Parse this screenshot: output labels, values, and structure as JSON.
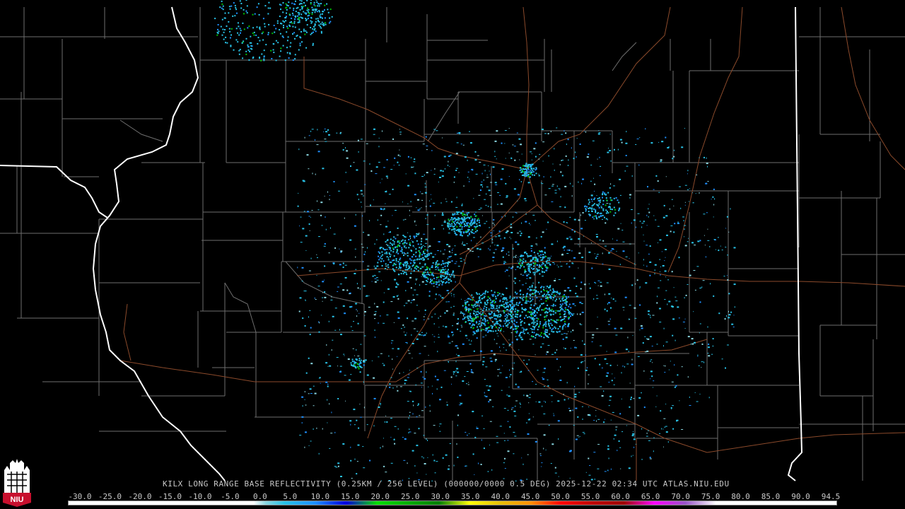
{
  "product": {
    "caption": "KILX LONG RANGE BASE REFLECTIVITY (0.25KM / 256 LEVEL) (000000/0000 0.5 DEG) 2025-12-22 02:34 UTC  ATLAS.NIU.EDU",
    "station": "KILX",
    "datetime": "2025-12-22 02:34 UTC",
    "source": "ATLAS.NIU.EDU"
  },
  "logo": {
    "text": "NIU",
    "bg_color": "#c8102e"
  },
  "colorbar": {
    "ticks": [
      "-30.0",
      "-25.0",
      "-20.0",
      "-15.0",
      "-10.0",
      "-5.0",
      "0.0",
      "5.0",
      "10.0",
      "15.0",
      "20.0",
      "25.0",
      "30.0",
      "35.0",
      "40.0",
      "45.0",
      "50.0",
      "55.0",
      "60.0",
      "65.0",
      "70.0",
      "75.0",
      "80.0",
      "85.0",
      "90.0",
      "94.5"
    ],
    "stops": [
      {
        "dbz": -30,
        "color": "#ffffff"
      },
      {
        "dbz": 0,
        "color": "#ffffff"
      },
      {
        "dbz": 2,
        "color": "#8ad6e0"
      },
      {
        "dbz": 5,
        "color": "#29c3e8"
      },
      {
        "dbz": 10,
        "color": "#1e90ff"
      },
      {
        "dbz": 15,
        "color": "#0000e0"
      },
      {
        "dbz": 20,
        "color": "#00e000"
      },
      {
        "dbz": 25,
        "color": "#00b000"
      },
      {
        "dbz": 30,
        "color": "#008000"
      },
      {
        "dbz": 35,
        "color": "#ffff00"
      },
      {
        "dbz": 40,
        "color": "#e8c000"
      },
      {
        "dbz": 45,
        "color": "#ff9000"
      },
      {
        "dbz": 50,
        "color": "#ff0000"
      },
      {
        "dbz": 55,
        "color": "#c00000"
      },
      {
        "dbz": 60,
        "color": "#a00000"
      },
      {
        "dbz": 65,
        "color": "#ff00ff"
      },
      {
        "dbz": 70,
        "color": "#9955c9"
      },
      {
        "dbz": 75,
        "color": "#ffffff"
      },
      {
        "dbz": 94.5,
        "color": "#ffffff"
      }
    ]
  },
  "map_colors": {
    "background": "#000000",
    "county_lines": "#6e6e6e",
    "state_lines": "#ffffff",
    "highways": "#8b4a2b"
  }
}
